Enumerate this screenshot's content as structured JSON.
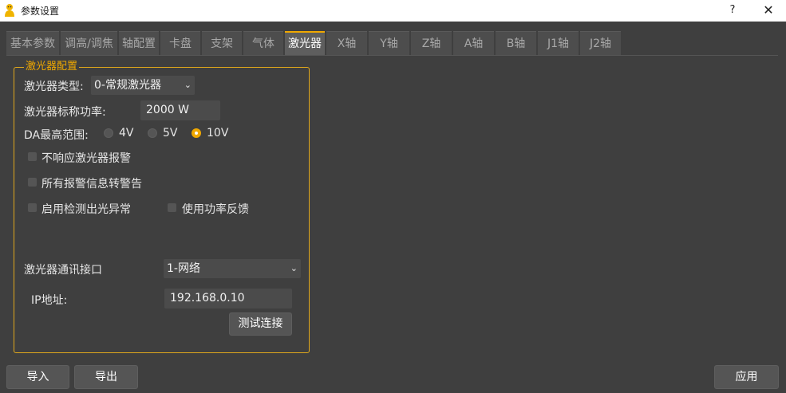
{
  "window": {
    "title": "参数设置",
    "help_label": "?",
    "close_label": "✕"
  },
  "tabs": [
    {
      "label": "基本参数"
    },
    {
      "label": "调高/调焦"
    },
    {
      "label": "轴配置"
    },
    {
      "label": "卡盘"
    },
    {
      "label": "支架"
    },
    {
      "label": "气体"
    },
    {
      "label": "激光器",
      "active": true
    },
    {
      "label": "X轴"
    },
    {
      "label": "Y轴"
    },
    {
      "label": "Z轴"
    },
    {
      "label": "A轴"
    },
    {
      "label": "B轴"
    },
    {
      "label": "J1轴"
    },
    {
      "label": "J2轴"
    }
  ],
  "laser_group": {
    "title": "激光器配置",
    "type_label": "激光器类型:",
    "type_value": "0-常规激光器",
    "power_label": "激光器标称功率:",
    "power_value": "2000 W",
    "da_label": "DA最高范围:",
    "da_options": [
      "4V",
      "5V",
      "10V"
    ],
    "da_selected": "10V",
    "chk_no_alarm": "不响应激光器报警",
    "chk_alarm_to_warning": "所有报警信息转警告",
    "chk_detect_light": "启用检测出光异常",
    "chk_power_feedback": "使用功率反馈",
    "comm_label": "激光器通讯接口",
    "comm_value": "1-网络",
    "ip_label": "IP地址:",
    "ip_value": "192.168.0.10",
    "test_button": "测试连接"
  },
  "footer": {
    "import_label": "导入",
    "export_label": "导出",
    "apply_label": "应用"
  },
  "colors": {
    "accent": "#f0a800",
    "background": "#3f3f3f"
  }
}
